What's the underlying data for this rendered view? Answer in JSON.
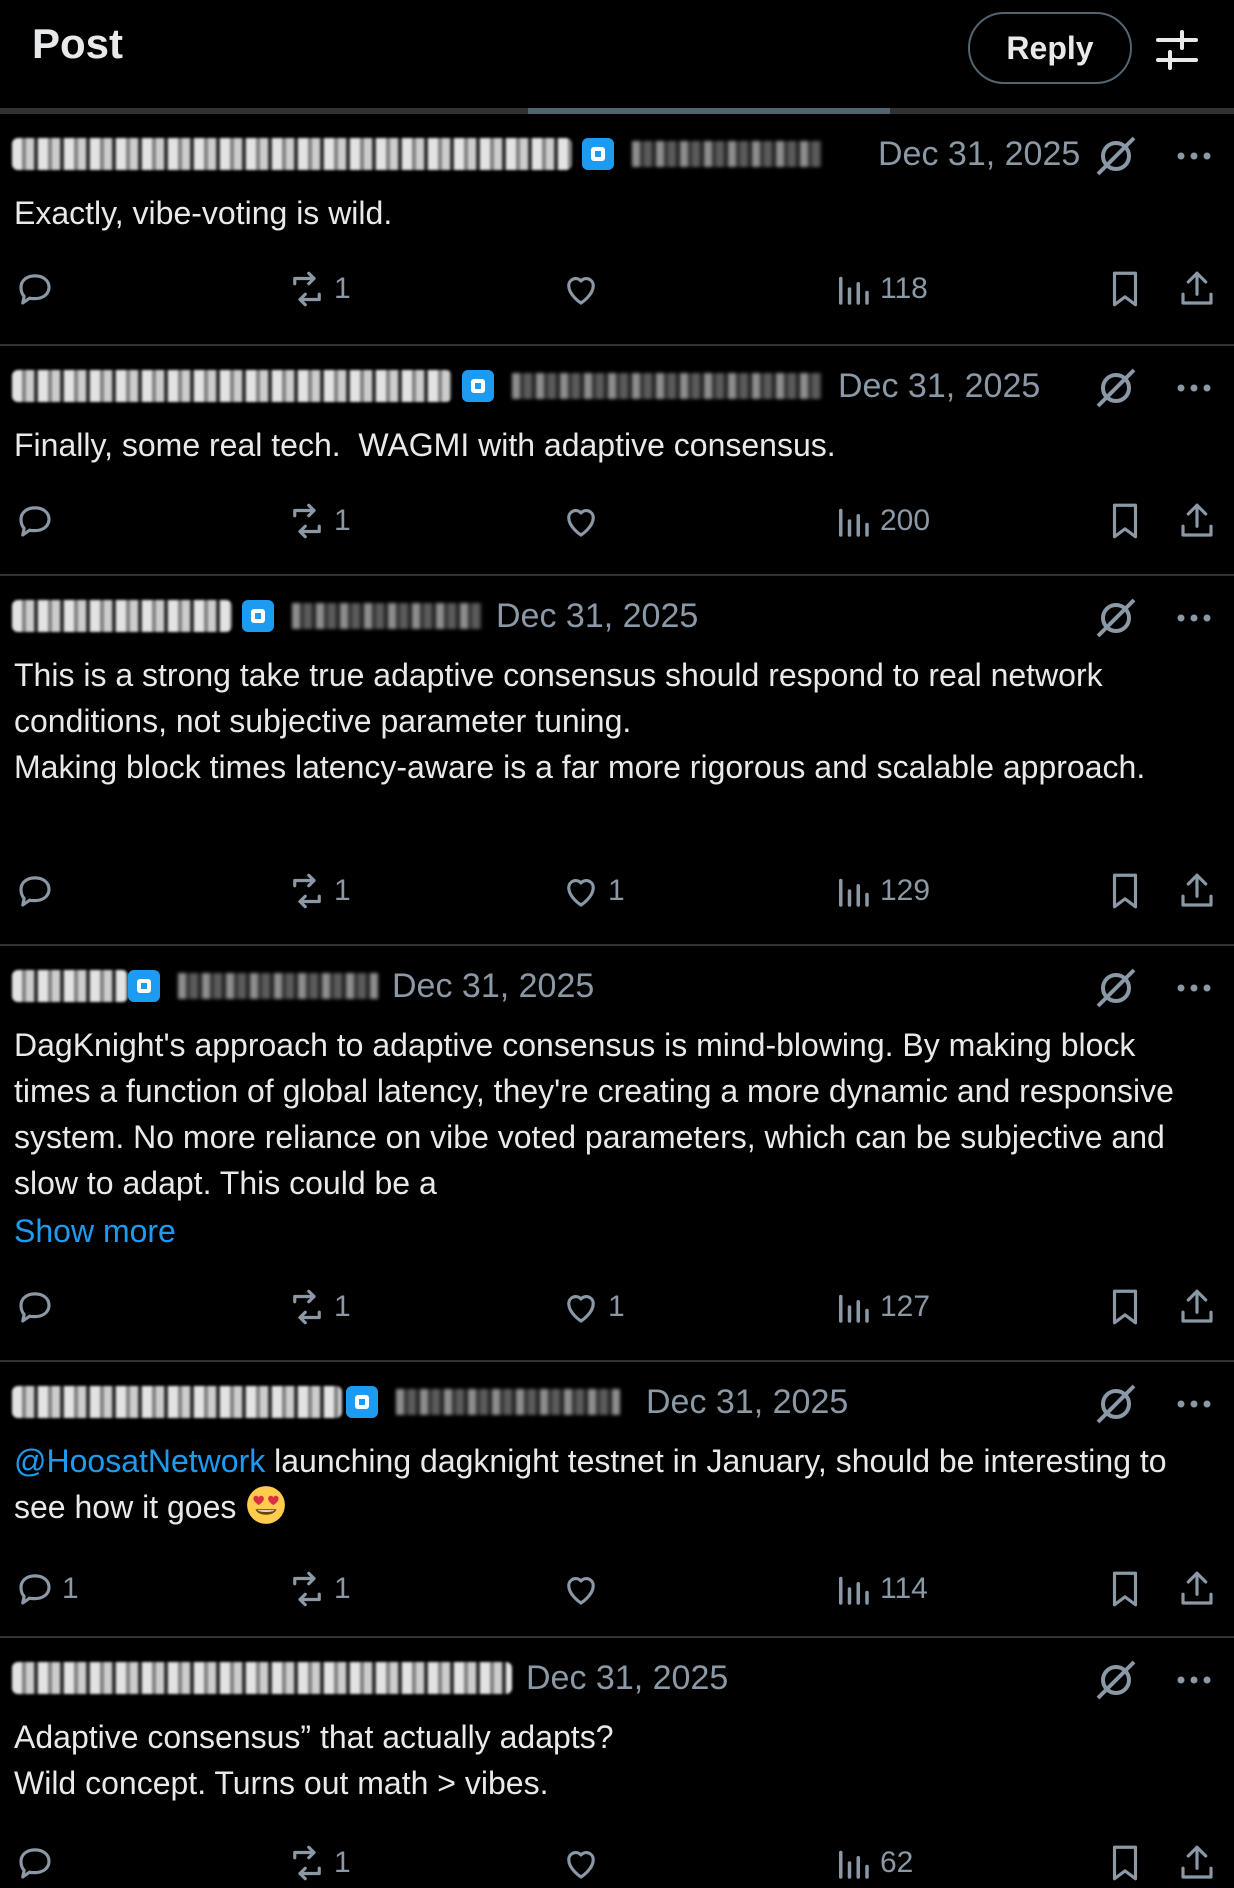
{
  "header": {
    "title": "Post",
    "reply_button": "Reply",
    "settings_icon": "sliders-icon",
    "progress_fraction": 0.29
  },
  "posts": [
    {
      "date": "Dec 31, 2025",
      "text": "Exactly, vibe-voting is wild.",
      "stats": {
        "replies": "",
        "reposts": "1",
        "likes": "",
        "views": "118"
      }
    },
    {
      "date": "Dec 31, 2025",
      "text": "Finally, some real tech.  WAGMI with adaptive consensus.",
      "stats": {
        "replies": "",
        "reposts": "1",
        "likes": "",
        "views": "200"
      }
    },
    {
      "date": "Dec 31, 2025",
      "text": "This is a strong take true adaptive consensus should respond to real network conditions, not subjective parameter tuning.\nMaking block times latency-aware is a far more rigorous and scalable approach.",
      "stats": {
        "replies": "",
        "reposts": "1",
        "likes": "1",
        "views": "129"
      }
    },
    {
      "date": "Dec 31, 2025",
      "text": "DagKnight's approach to adaptive consensus is mind-blowing. By making block times a function of global latency, they're creating a more dynamic and responsive system. No more reliance on vibe voted parameters, which can be subjective and slow to adapt. This could be a",
      "show_more": "Show more",
      "stats": {
        "replies": "",
        "reposts": "1",
        "likes": "1",
        "views": "127"
      }
    },
    {
      "date": "Dec 31, 2025",
      "mention": "@HoosatNetwork",
      "text": " launching dagknight testnet in January, should be interesting to see how it goes ",
      "emoji": "heart-eyes-emoji",
      "stats": {
        "replies": "1",
        "reposts": "1",
        "likes": "",
        "views": "114"
      }
    },
    {
      "date": "Dec 31, 2025",
      "text": "Adaptive consensus” that actually adapts?\nWild concept. Turns out math > vibes.",
      "stats": {
        "replies": "",
        "reposts": "1",
        "likes": "",
        "views": "62"
      }
    }
  ],
  "colors": {
    "background": "#000000",
    "text": "#e7e9ea",
    "muted": "#8b98a5",
    "link": "#1d9bf0",
    "divider": "#2f3336"
  }
}
